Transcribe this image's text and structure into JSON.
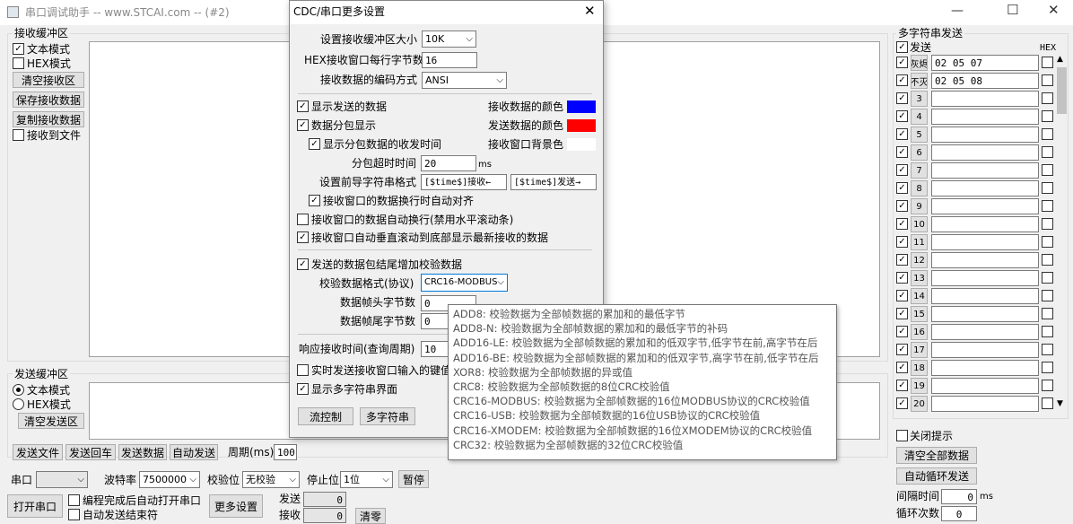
{
  "main_window": {
    "title": "串口调试助手 -- www.STCAI.com -- (#2)",
    "controls": {
      "minimize": "—",
      "maximize": "☐",
      "close": "✕"
    }
  },
  "receive_panel": {
    "group_title": "接收缓冲区",
    "text_mode": "文本模式",
    "hex_mode": "HEX模式",
    "clear_btn": "清空接收区",
    "save_btn": "保存接收数据",
    "copy_btn": "复制接收数据",
    "to_file": "接收到文件"
  },
  "send_panel": {
    "group_title": "发送缓冲区",
    "text_mode": "文本模式",
    "hex_mode": "HEX模式",
    "clear_btn": "清空发送区",
    "send_file_btn": "发送文件",
    "send_enter_btn": "发送回车",
    "send_data_btn": "发送数据",
    "auto_send_btn": "自动发送",
    "period_label": "周期(ms)",
    "period_value": "100"
  },
  "serial_bar": {
    "port_label": "串口",
    "baud_label": "波特率",
    "baud_value": "7500000",
    "parity_label": "校验位",
    "parity_value": "无校验",
    "stop_label": "停止位",
    "stop_value": "1位",
    "pause_btn": "暂停",
    "open_btn": "打开串口",
    "auto_open_label": "编程完成后自动打开串口",
    "auto_end_label": "自动发送结束符",
    "more_btn": "更多设置",
    "sent_label": "发送",
    "sent_value": "0",
    "recv_label": "接收",
    "recv_value": "0",
    "clear_btn": "清零"
  },
  "multi_panel": {
    "group_title": "多字符串发送",
    "send_header": "发送",
    "hex_header": "HEX",
    "rows": [
      {
        "label": "灰烬",
        "value": "02 05 07"
      },
      {
        "label": "不灭",
        "value": "02 05 08"
      },
      {
        "label": "3",
        "value": ""
      },
      {
        "label": "4",
        "value": ""
      },
      {
        "label": "5",
        "value": ""
      },
      {
        "label": "6",
        "value": ""
      },
      {
        "label": "7",
        "value": ""
      },
      {
        "label": "8",
        "value": ""
      },
      {
        "label": "9",
        "value": ""
      },
      {
        "label": "10",
        "value": ""
      },
      {
        "label": "11",
        "value": ""
      },
      {
        "label": "12",
        "value": ""
      },
      {
        "label": "13",
        "value": ""
      },
      {
        "label": "14",
        "value": ""
      },
      {
        "label": "15",
        "value": ""
      },
      {
        "label": "16",
        "value": ""
      },
      {
        "label": "17",
        "value": ""
      },
      {
        "label": "18",
        "value": ""
      },
      {
        "label": "19",
        "value": ""
      },
      {
        "label": "20",
        "value": ""
      }
    ],
    "close_hint": "关闭提示",
    "clear_all_btn": "清空全部数据",
    "auto_loop_btn": "自动循环发送",
    "interval_label": "间隔时间",
    "interval_value": "0",
    "interval_unit": "ms",
    "loop_label": "循环次数",
    "loop_value": "0"
  },
  "dialog": {
    "title": "CDC/串口更多设置",
    "buf_size_label": "设置接收缓冲区大小",
    "buf_size_value": "10K",
    "hex_bytes_label": "HEX接收窗口每行字节数",
    "hex_bytes_value": "16",
    "encoding_label": "接收数据的编码方式",
    "encoding_value": "ANSI",
    "show_sent": "显示发送的数据",
    "split_show": "数据分包显示",
    "show_time": "显示分包数据的收发时间",
    "recv_color_label": "接收数据的颜色",
    "recv_color": "#0000ff",
    "send_color_label": "发送数据的颜色",
    "send_color": "#ff0000",
    "bg_color_label": "接收窗口背景色",
    "bg_color": "#ffffff",
    "timeout_label": "分包超时时间",
    "timeout_value": "20",
    "timeout_unit": "ms",
    "prefix_label": "设置前导字符串格式",
    "prefix_recv": "[$time$]接收←",
    "prefix_send": "[$time$]发送→",
    "auto_align": "接收窗口的数据换行时自动对齐",
    "auto_wrap": "接收窗口的数据自动换行(禁用水平滚动条)",
    "auto_scroll": "接收窗口自动垂直滚动到底部显示最新接收的数据",
    "append_check": "发送的数据包结尾增加校验数据",
    "check_format_label": "校验数据格式(协议)",
    "check_format_value": "CRC16-MODBUS",
    "head_bytes_label": "数据帧头字节数",
    "head_bytes_value": "0",
    "tail_bytes_label": "数据帧尾字节数",
    "tail_bytes_value": "0",
    "resp_time_label": "响应接收时间(查询周期)",
    "resp_time_value": "10",
    "realtime_send": "实时发送接收窗口输入的键值",
    "show_multi": "显示多字符串界面",
    "flow_btn": "流控制",
    "multi_btn": "多字符串",
    "close_icon": "✕"
  },
  "dropdown": {
    "options": [
      "ADD8: 校验数据为全部帧数据的累加和的最低字节",
      "ADD8-N: 校验数据为全部帧数据的累加和的最低字节的补码",
      "ADD16-LE: 校验数据为全部帧数据的累加和的低双字节,低字节在前,高字节在后",
      "ADD16-BE: 校验数据为全部帧数据的累加和的低双字节,高字节在前,低字节在后",
      "XOR8: 校验数据为全部帧数据的异或值",
      "CRC8: 校验数据为全部帧数据的8位CRC校验值",
      "CRC16-MODBUS: 校验数据为全部帧数据的16位MODBUS协议的CRC校验值",
      "CRC16-USB: 校验数据为全部帧数据的16位USB协议的CRC校验值",
      "CRC16-XMODEM: 校验数据为全部帧数据的16位XMODEM协议的CRC校验值",
      "CRC32: 校验数据为全部帧数据的32位CRC校验值"
    ]
  }
}
